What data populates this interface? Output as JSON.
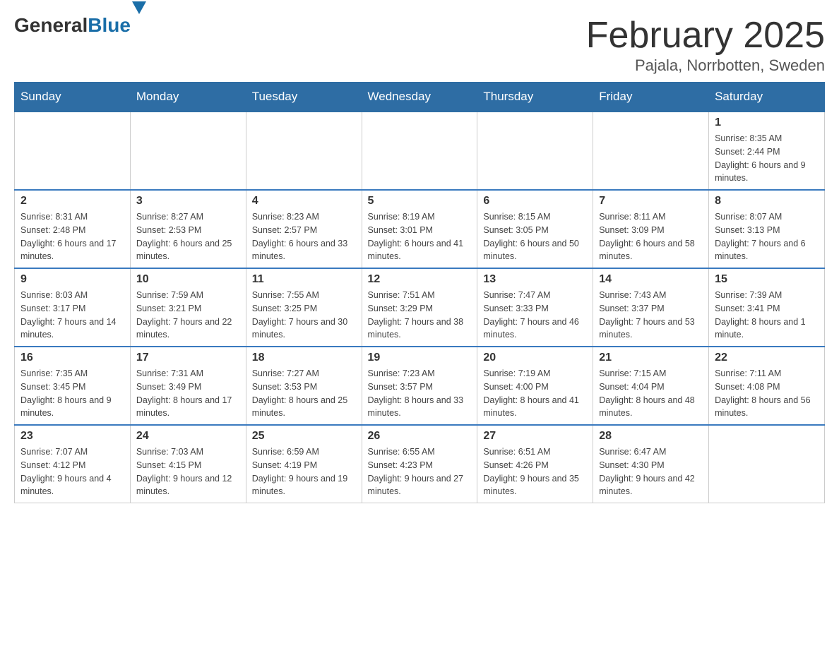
{
  "header": {
    "logo": {
      "general": "General",
      "blue": "Blue"
    },
    "title": "February 2025",
    "location": "Pajala, Norrbotten, Sweden"
  },
  "weekdays": [
    "Sunday",
    "Monday",
    "Tuesday",
    "Wednesday",
    "Thursday",
    "Friday",
    "Saturday"
  ],
  "weeks": [
    [
      {
        "day": "",
        "info": ""
      },
      {
        "day": "",
        "info": ""
      },
      {
        "day": "",
        "info": ""
      },
      {
        "day": "",
        "info": ""
      },
      {
        "day": "",
        "info": ""
      },
      {
        "day": "",
        "info": ""
      },
      {
        "day": "1",
        "info": "Sunrise: 8:35 AM\nSunset: 2:44 PM\nDaylight: 6 hours and 9 minutes."
      }
    ],
    [
      {
        "day": "2",
        "info": "Sunrise: 8:31 AM\nSunset: 2:48 PM\nDaylight: 6 hours and 17 minutes."
      },
      {
        "day": "3",
        "info": "Sunrise: 8:27 AM\nSunset: 2:53 PM\nDaylight: 6 hours and 25 minutes."
      },
      {
        "day": "4",
        "info": "Sunrise: 8:23 AM\nSunset: 2:57 PM\nDaylight: 6 hours and 33 minutes."
      },
      {
        "day": "5",
        "info": "Sunrise: 8:19 AM\nSunset: 3:01 PM\nDaylight: 6 hours and 41 minutes."
      },
      {
        "day": "6",
        "info": "Sunrise: 8:15 AM\nSunset: 3:05 PM\nDaylight: 6 hours and 50 minutes."
      },
      {
        "day": "7",
        "info": "Sunrise: 8:11 AM\nSunset: 3:09 PM\nDaylight: 6 hours and 58 minutes."
      },
      {
        "day": "8",
        "info": "Sunrise: 8:07 AM\nSunset: 3:13 PM\nDaylight: 7 hours and 6 minutes."
      }
    ],
    [
      {
        "day": "9",
        "info": "Sunrise: 8:03 AM\nSunset: 3:17 PM\nDaylight: 7 hours and 14 minutes."
      },
      {
        "day": "10",
        "info": "Sunrise: 7:59 AM\nSunset: 3:21 PM\nDaylight: 7 hours and 22 minutes."
      },
      {
        "day": "11",
        "info": "Sunrise: 7:55 AM\nSunset: 3:25 PM\nDaylight: 7 hours and 30 minutes."
      },
      {
        "day": "12",
        "info": "Sunrise: 7:51 AM\nSunset: 3:29 PM\nDaylight: 7 hours and 38 minutes."
      },
      {
        "day": "13",
        "info": "Sunrise: 7:47 AM\nSunset: 3:33 PM\nDaylight: 7 hours and 46 minutes."
      },
      {
        "day": "14",
        "info": "Sunrise: 7:43 AM\nSunset: 3:37 PM\nDaylight: 7 hours and 53 minutes."
      },
      {
        "day": "15",
        "info": "Sunrise: 7:39 AM\nSunset: 3:41 PM\nDaylight: 8 hours and 1 minute."
      }
    ],
    [
      {
        "day": "16",
        "info": "Sunrise: 7:35 AM\nSunset: 3:45 PM\nDaylight: 8 hours and 9 minutes."
      },
      {
        "day": "17",
        "info": "Sunrise: 7:31 AM\nSunset: 3:49 PM\nDaylight: 8 hours and 17 minutes."
      },
      {
        "day": "18",
        "info": "Sunrise: 7:27 AM\nSunset: 3:53 PM\nDaylight: 8 hours and 25 minutes."
      },
      {
        "day": "19",
        "info": "Sunrise: 7:23 AM\nSunset: 3:57 PM\nDaylight: 8 hours and 33 minutes."
      },
      {
        "day": "20",
        "info": "Sunrise: 7:19 AM\nSunset: 4:00 PM\nDaylight: 8 hours and 41 minutes."
      },
      {
        "day": "21",
        "info": "Sunrise: 7:15 AM\nSunset: 4:04 PM\nDaylight: 8 hours and 48 minutes."
      },
      {
        "day": "22",
        "info": "Sunrise: 7:11 AM\nSunset: 4:08 PM\nDaylight: 8 hours and 56 minutes."
      }
    ],
    [
      {
        "day": "23",
        "info": "Sunrise: 7:07 AM\nSunset: 4:12 PM\nDaylight: 9 hours and 4 minutes."
      },
      {
        "day": "24",
        "info": "Sunrise: 7:03 AM\nSunset: 4:15 PM\nDaylight: 9 hours and 12 minutes."
      },
      {
        "day": "25",
        "info": "Sunrise: 6:59 AM\nSunset: 4:19 PM\nDaylight: 9 hours and 19 minutes."
      },
      {
        "day": "26",
        "info": "Sunrise: 6:55 AM\nSunset: 4:23 PM\nDaylight: 9 hours and 27 minutes."
      },
      {
        "day": "27",
        "info": "Sunrise: 6:51 AM\nSunset: 4:26 PM\nDaylight: 9 hours and 35 minutes."
      },
      {
        "day": "28",
        "info": "Sunrise: 6:47 AM\nSunset: 4:30 PM\nDaylight: 9 hours and 42 minutes."
      },
      {
        "day": "",
        "info": ""
      }
    ]
  ]
}
